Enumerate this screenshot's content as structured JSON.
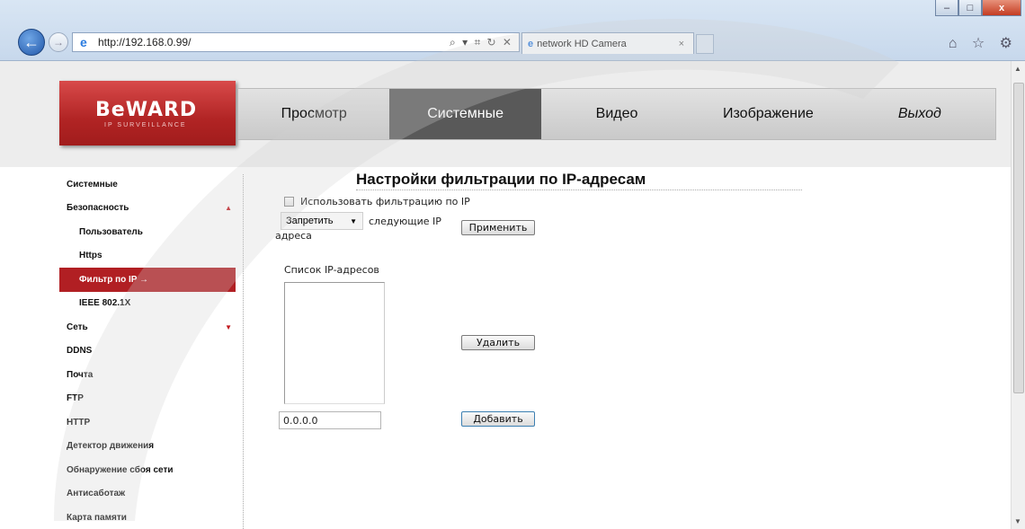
{
  "browser": {
    "url": "http://192.168.0.99/",
    "address_tools": "⌕ ▾ ⌗ ↻ ✕",
    "tab_title": "network HD Camera",
    "tab_close": "×",
    "window_controls": [
      "–",
      "□",
      "x"
    ],
    "right_icons": "⌂ ☆ ⚙"
  },
  "header": {
    "logo_text": "BeWARD",
    "logo_sub": "IP SURVEILLANCE",
    "nav": [
      {
        "label": "Просмотр"
      },
      {
        "label": "Системные"
      },
      {
        "label": "Видео"
      },
      {
        "label": "Изображение"
      },
      {
        "label": "Выход"
      }
    ],
    "active_nav": "Системные"
  },
  "sidebar": {
    "items": [
      {
        "label": "Системные"
      },
      {
        "label": "Безопасность",
        "arrow": "▲"
      },
      {
        "label": "Пользователь"
      },
      {
        "label": "Https"
      },
      {
        "label": "Фильтр по IP →"
      },
      {
        "label": "IEEE 802.1X"
      },
      {
        "label": "Сеть",
        "arrow": "▼"
      },
      {
        "label": "DDNS"
      },
      {
        "label": "Почта"
      },
      {
        "label": "FTP"
      },
      {
        "label": "HTTP"
      },
      {
        "label": "Детектор движения"
      },
      {
        "label": "Обнаружение сбоя сети"
      },
      {
        "label": "Антисаботаж"
      },
      {
        "label": "Карта памяти"
      }
    ],
    "active_item": "Фильтр по IP"
  },
  "main": {
    "title": "Настройки фильтрации по IP-адресам",
    "use_filter_label": "Использовать фильтрацию по IP",
    "use_filter_checked": false,
    "mode_select_value": "Запретить",
    "mode_label_1": "следующие IP",
    "mode_label_2": "адреса",
    "apply_button": "Применить",
    "list_label": "Список IP-адресов",
    "ip_list": [],
    "delete_button": "Удалить",
    "ip_input_value": "0.0.0.0",
    "add_button": "Добавить"
  },
  "colors": {
    "brand_red": "#b11f23",
    "active_nav_bg": "#595959"
  }
}
